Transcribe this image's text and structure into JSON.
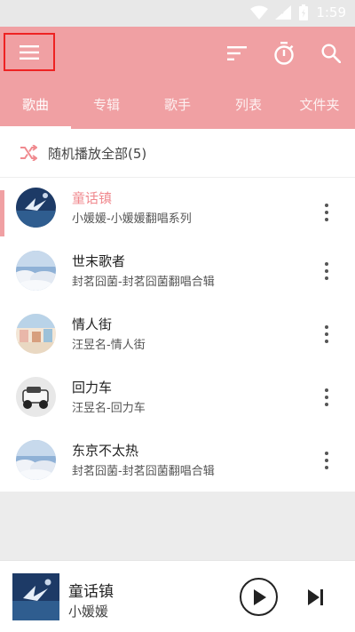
{
  "status": {
    "time": "1:59"
  },
  "colors": {
    "accent": "#f0a0a3",
    "current_title": "#f08a8f",
    "highlight_box": "#ee2222"
  },
  "toolbar": {
    "menu_icon": "hamburger-menu-icon",
    "sort_icon": "sort-icon",
    "timer_icon": "timer-icon",
    "search_icon": "search-icon"
  },
  "tabs": [
    {
      "label": "歌曲",
      "active": true
    },
    {
      "label": "专辑",
      "active": false
    },
    {
      "label": "歌手",
      "active": false
    },
    {
      "label": "列表",
      "active": false
    },
    {
      "label": "文件夹",
      "active": false
    }
  ],
  "shuffle": {
    "label": "随机播放全部(5)",
    "icon": "shuffle-icon"
  },
  "songs": [
    {
      "title": "童话镇",
      "subtitle": "小媛媛-小媛媛翻唱系列",
      "current": true
    },
    {
      "title": "世末歌者",
      "subtitle": "封茗囧菌-封茗囧菌翻唱合辑",
      "current": false
    },
    {
      "title": "情人街",
      "subtitle": "汪昱名-情人街",
      "current": false
    },
    {
      "title": "回力车",
      "subtitle": "汪昱名-回力车",
      "current": false
    },
    {
      "title": "东京不太热",
      "subtitle": "封茗囧菌-封茗囧菌翻唱合辑",
      "current": false
    }
  ],
  "player": {
    "title": "童话镇",
    "artist": "小媛媛",
    "play_icon": "play-icon",
    "next_icon": "skip-next-icon"
  }
}
